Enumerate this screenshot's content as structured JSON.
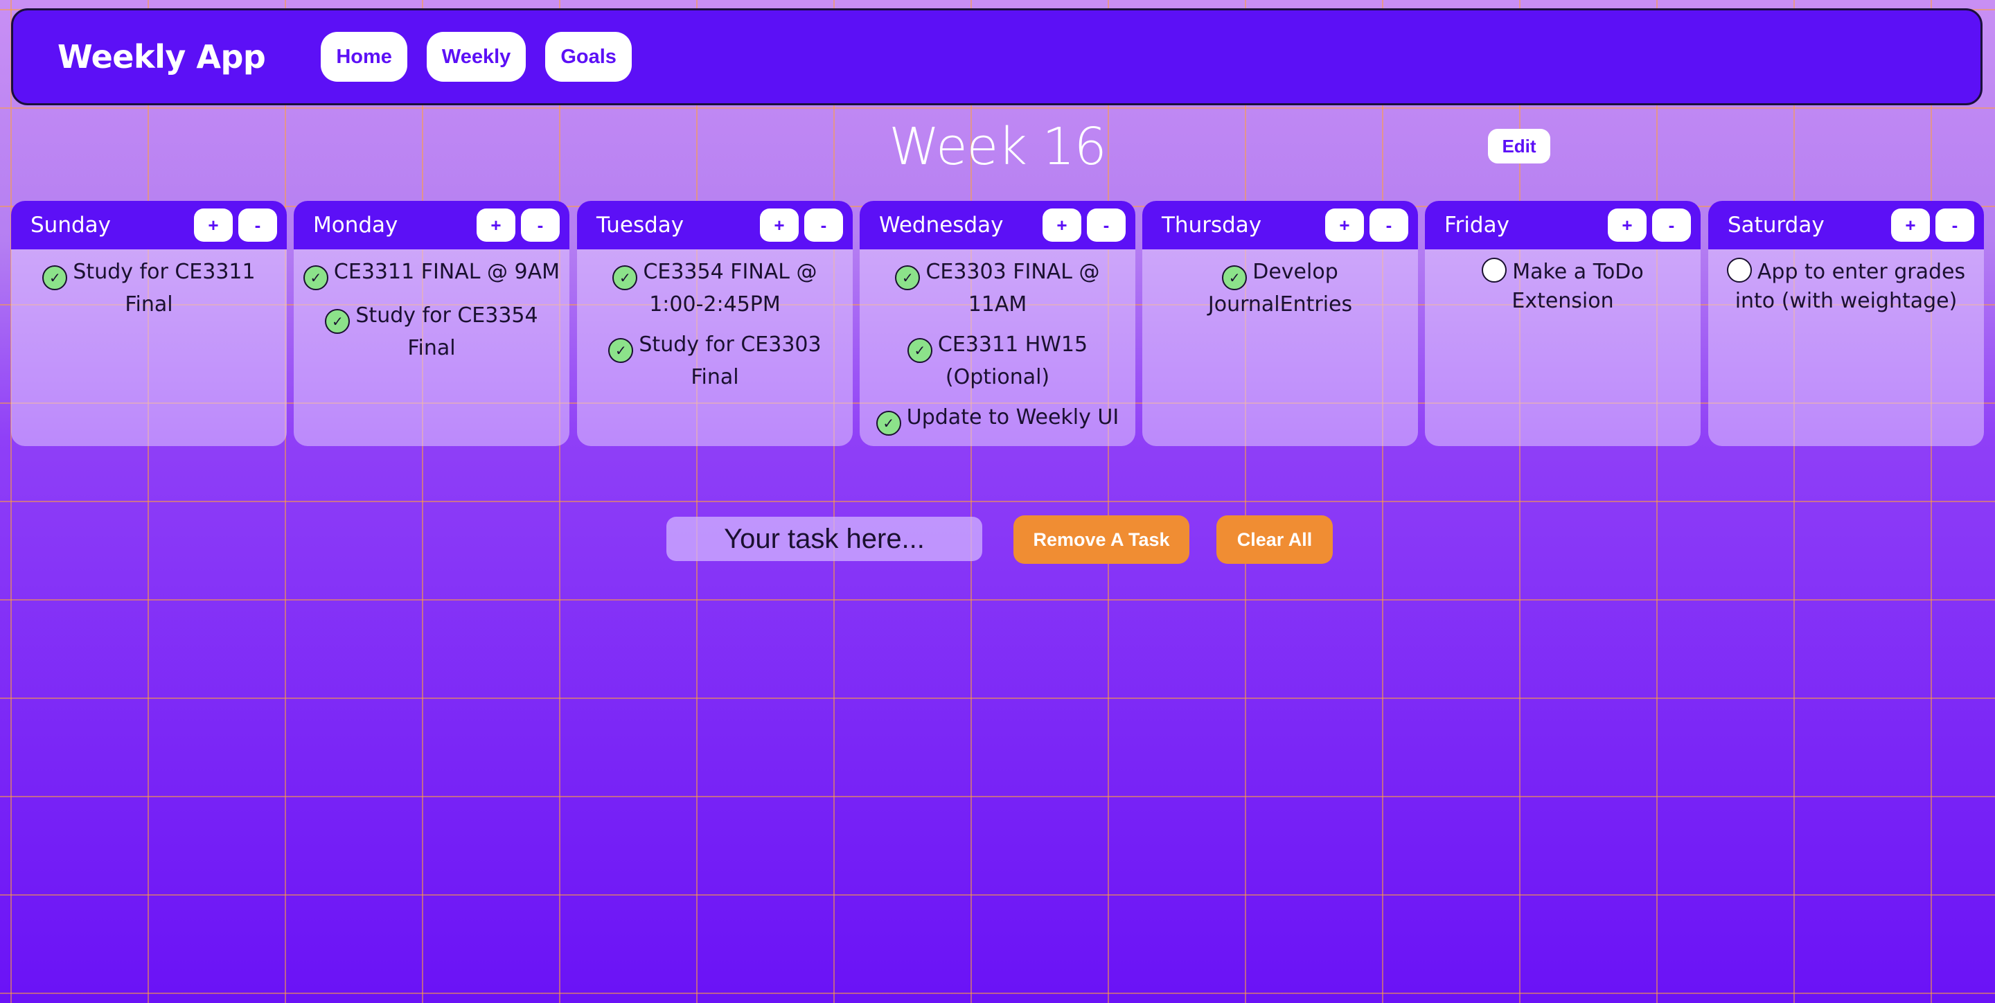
{
  "navbar": {
    "brand": "Weekly App",
    "links": [
      "Home",
      "Weekly",
      "Goals"
    ]
  },
  "week": {
    "title": "Week 16",
    "edit_label": "Edit"
  },
  "controls": {
    "add": "+",
    "remove": "-"
  },
  "days": [
    {
      "name": "Sunday",
      "tasks": [
        {
          "text": "Study for CE3311 Final",
          "done": true
        }
      ]
    },
    {
      "name": "Monday",
      "tasks": [
        {
          "text": "CE3311 FINAL @ 9AM",
          "done": true
        },
        {
          "text": "Study for CE3354 Final",
          "done": true
        }
      ]
    },
    {
      "name": "Tuesday",
      "tasks": [
        {
          "text": "CE3354 FINAL @ 1:00-2:45PM",
          "done": true
        },
        {
          "text": "Study for CE3303 Final",
          "done": true
        }
      ]
    },
    {
      "name": "Wednesday",
      "tasks": [
        {
          "text": "CE3303 FINAL @ 11AM",
          "done": true
        },
        {
          "text": "CE3311 HW15 (Optional)",
          "done": true
        },
        {
          "text": "Update to Weekly UI",
          "done": true
        }
      ]
    },
    {
      "name": "Thursday",
      "tasks": [
        {
          "text": "Develop JournalEntries",
          "done": true
        }
      ]
    },
    {
      "name": "Friday",
      "tasks": [
        {
          "text": "Make a ToDo Extension",
          "done": false
        }
      ]
    },
    {
      "name": "Saturday",
      "tasks": [
        {
          "text": "App to enter grades into (with weightage)",
          "done": false
        }
      ]
    }
  ],
  "task_form": {
    "placeholder": "Your task here...",
    "remove_label": "Remove A Task",
    "clear_label": "Clear All"
  },
  "icons": {
    "done_check": "✓"
  },
  "colors": {
    "brand": "#5c10f6",
    "accent_orange": "#f08d33",
    "check_done": "#8ce28a"
  }
}
